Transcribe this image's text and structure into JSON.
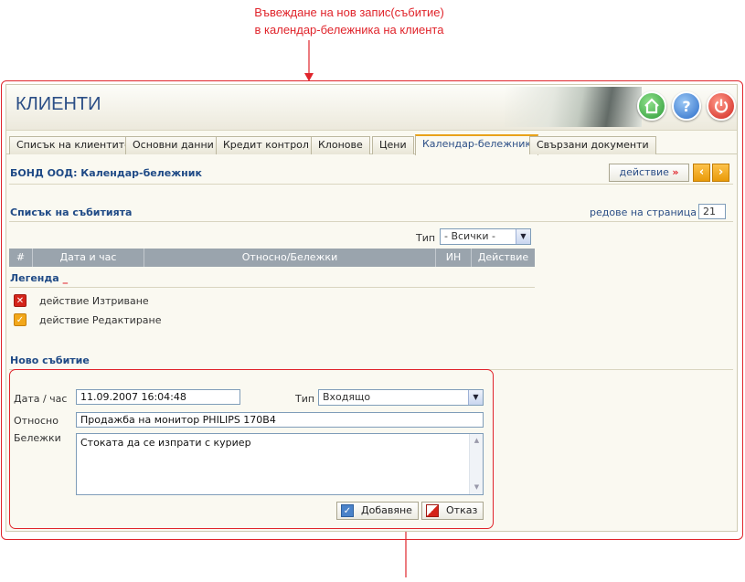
{
  "annotation": {
    "line1": "Въвеждане на нов запис(събитие)",
    "line2": "в календар-бележника на клиента"
  },
  "colors": {
    "annotation": "#e0242b",
    "title": "#2b4e86",
    "tab_active_accent": "#e8a21a"
  },
  "header": {
    "title": "КЛИЕНТИ",
    "buttons": [
      {
        "icon": "home-icon"
      },
      {
        "icon": "help-icon",
        "glyph": "?"
      },
      {
        "icon": "power-icon"
      }
    ]
  },
  "tabs": [
    {
      "label": "Списък на клиентите",
      "active": false
    },
    {
      "label": "Основни данни",
      "active": false
    },
    {
      "label": "Кредит контрол",
      "active": false
    },
    {
      "label": "Клонове",
      "active": false
    },
    {
      "label": "Цени",
      "active": false
    },
    {
      "label": "Календар-бележник",
      "active": true
    },
    {
      "label": "Свързани документи",
      "active": false
    }
  ],
  "subheader": {
    "title": "БОНД ООД: Календар-бележник",
    "action_label": "действие",
    "action_arrow": "»",
    "prev": "‹",
    "next": "›"
  },
  "events_list": {
    "title": "Списък на събитията",
    "rows_per_page_label": "редове на страница",
    "rows_per_page_arrow": "»",
    "rows_per_page_value": "21",
    "type_filter_label": "Тип",
    "type_filter_value": "- Всички -",
    "columns": [
      "#",
      "Дата и час",
      "Относно/Бележки",
      "ИН",
      "Действие"
    ]
  },
  "legend": {
    "title": "Легенда",
    "items": [
      {
        "icon": "delete-icon",
        "label": "действие Изтриване"
      },
      {
        "icon": "edit-icon",
        "label": "действие Редактиране"
      }
    ]
  },
  "new_event": {
    "title": "Ново събитие",
    "date_label": "Дата / час",
    "date_value": "11.09.2007 16:04:48",
    "type_label": "Тип",
    "type_value": "Входящо",
    "subject_label": "Относно",
    "subject_value": "Продажба на монитор PHILIPS 170B4",
    "notes_label": "Бележки",
    "notes_value": "Стоката да се изпрати с куриер",
    "add_label": "Добавяне",
    "cancel_label": "Отказ"
  }
}
